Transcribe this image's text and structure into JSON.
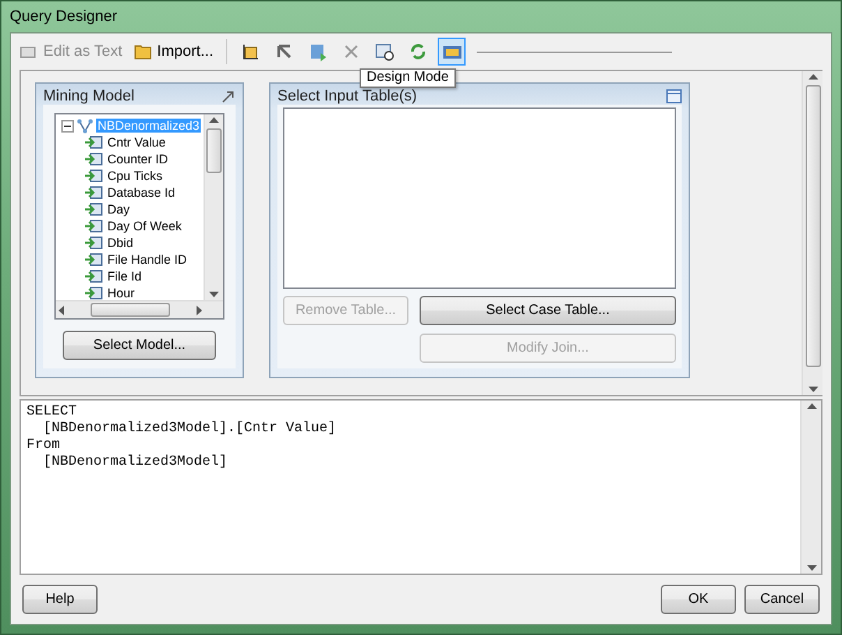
{
  "window": {
    "title": "Query Designer"
  },
  "toolbar": {
    "text_buttons": [
      {
        "label": "Edit as Text",
        "disabled": true
      },
      {
        "label": "Import...",
        "disabled": false
      }
    ],
    "icon_buttons": [
      {
        "kind": "add",
        "selected": false
      },
      {
        "kind": "back",
        "selected": false
      },
      {
        "kind": "run",
        "selected": false
      },
      {
        "kind": "delete",
        "selected": false
      },
      {
        "kind": "query",
        "selected": false
      },
      {
        "kind": "refresh",
        "selected": false
      },
      {
        "kind": "design",
        "selected": true
      }
    ],
    "tooltip": "Design Mode"
  },
  "mining_model": {
    "title": "Mining Model",
    "tree": {
      "label": "NBDenormalized3",
      "selected": true,
      "expanded": true,
      "children": [
        {
          "label": "Cntr Value"
        },
        {
          "label": "Counter ID"
        },
        {
          "label": "Cpu Ticks"
        },
        {
          "label": "Database Id"
        },
        {
          "label": "Day"
        },
        {
          "label": "Day Of Week"
        },
        {
          "label": "Dbid"
        },
        {
          "label": "File Handle ID"
        },
        {
          "label": "File Id"
        },
        {
          "label": "Hour"
        }
      ]
    },
    "button": "Select Model..."
  },
  "input_tables": {
    "title": "Select Input Table(s)",
    "buttons": [
      {
        "label": "Remove Table...",
        "disabled": true
      },
      {
        "label": "Select Case Table...",
        "disabled": false
      },
      {
        "label": "Modify Join...",
        "disabled": true
      }
    ]
  },
  "query": {
    "lines": [
      "SELECT",
      "  [NBDenormalized3Model].[Cntr Value]",
      "From",
      "  [NBDenormalized3Model]"
    ]
  },
  "footer": {
    "buttons": [
      {
        "label": "Help"
      },
      {
        "label": "OK"
      },
      {
        "label": "Cancel"
      }
    ]
  }
}
